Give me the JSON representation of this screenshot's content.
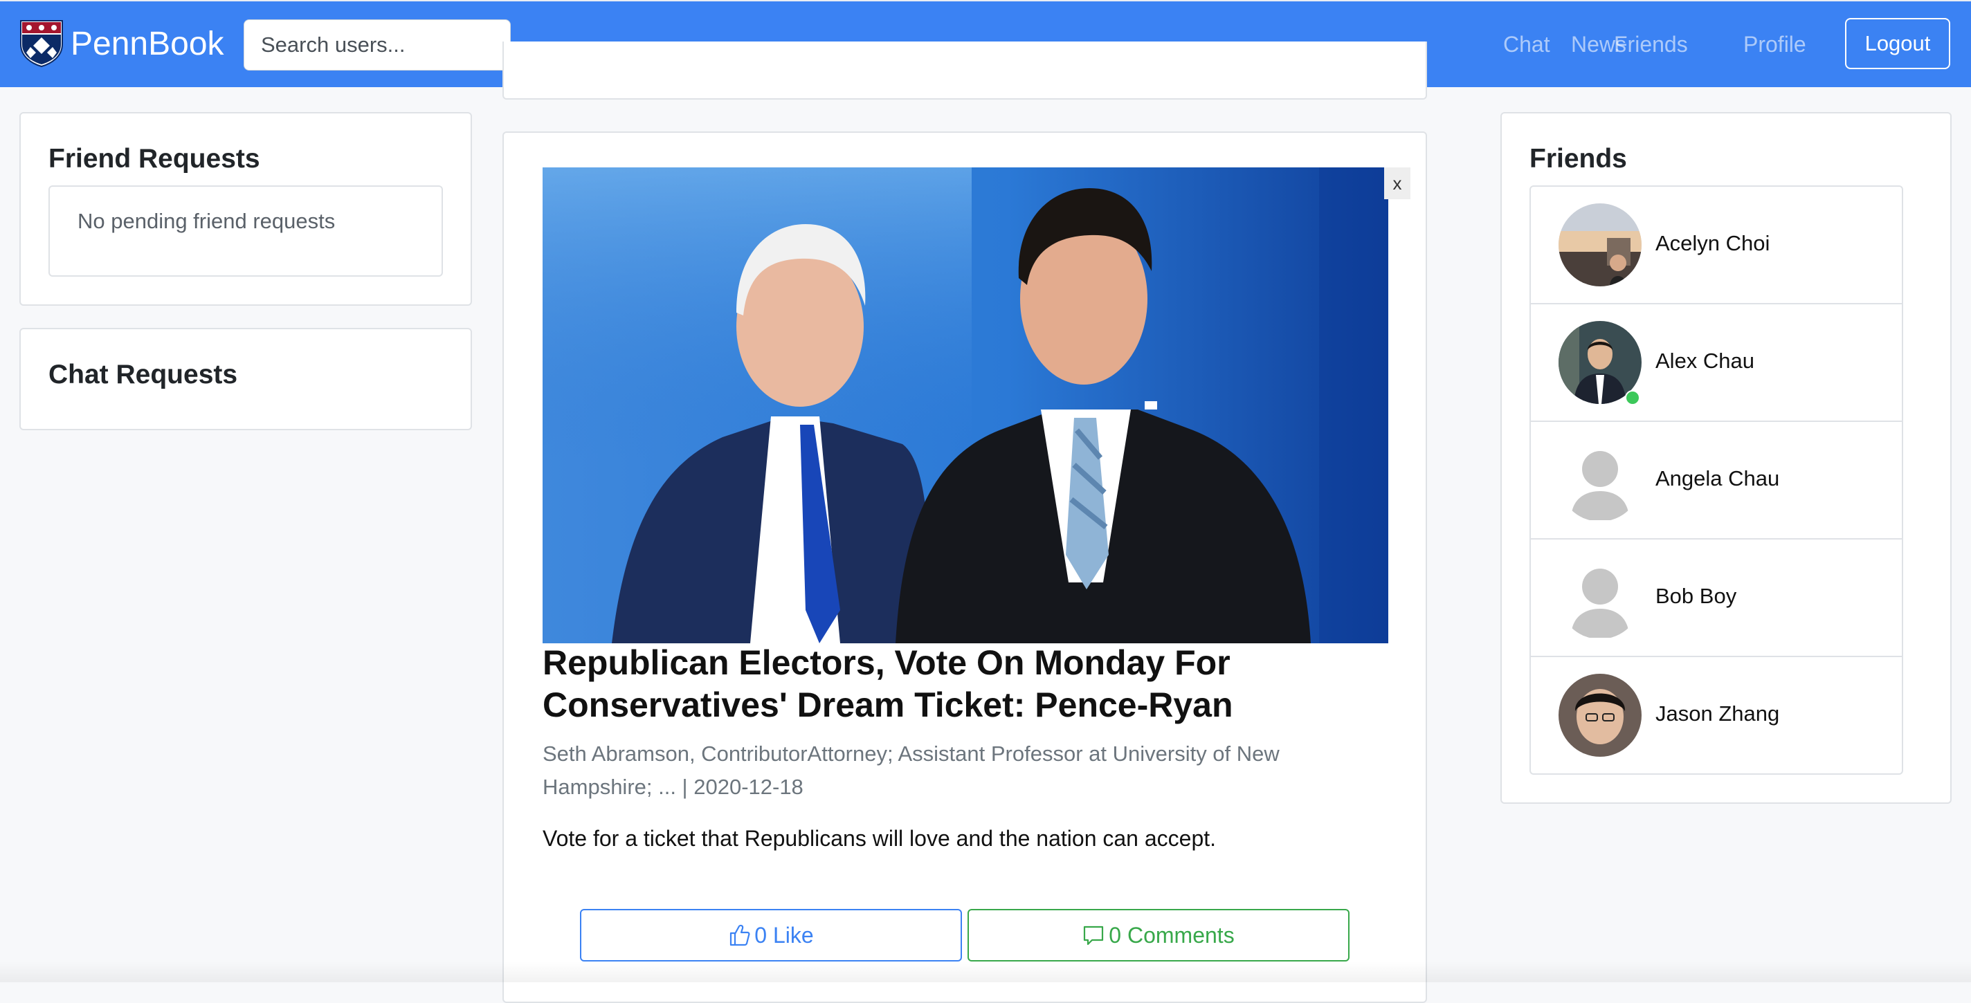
{
  "colors": {
    "navbar": "#3b82f3",
    "like": "#3b82f3",
    "comments": "#38a84a",
    "online": "#3cc85a"
  },
  "navbar": {
    "brand": "PennBook",
    "logo_icon": "penn-shield-icon",
    "search_placeholder": "Search users...",
    "links": {
      "chat": "Chat",
      "news": "News",
      "friends": "Friends",
      "profile": "Profile"
    },
    "logout": "Logout"
  },
  "friend_requests": {
    "title": "Friend Requests",
    "empty": "No pending friend requests"
  },
  "chat_requests": {
    "title": "Chat Requests"
  },
  "news": {
    "close": "x",
    "title": "Republican Electors, Vote On Monday For Conservatives' Dream Ticket: Pence-Ryan",
    "meta": "Seth Abramson, ContributorAttorney; Assistant Professor at University of New Hampshire; ... | 2020-12-18",
    "summary": "Vote for a ticket that Republicans will love and the nation can accept.",
    "like_icon": "thumbs-up-icon",
    "like_label": "0 Like",
    "comments_icon": "comment-icon",
    "comments_label": "0 Comments"
  },
  "friends": {
    "title": "Friends",
    "items": [
      {
        "name": "Acelyn Choi",
        "avatar": "photo",
        "online": false
      },
      {
        "name": "Alex Chau",
        "avatar": "photo",
        "online": true
      },
      {
        "name": "Angela Chau",
        "avatar": "default-user-icon",
        "online": false
      },
      {
        "name": "Bob Boy",
        "avatar": "default-user-icon",
        "online": false
      },
      {
        "name": "Jason Zhang",
        "avatar": "photo",
        "online": false
      }
    ]
  }
}
